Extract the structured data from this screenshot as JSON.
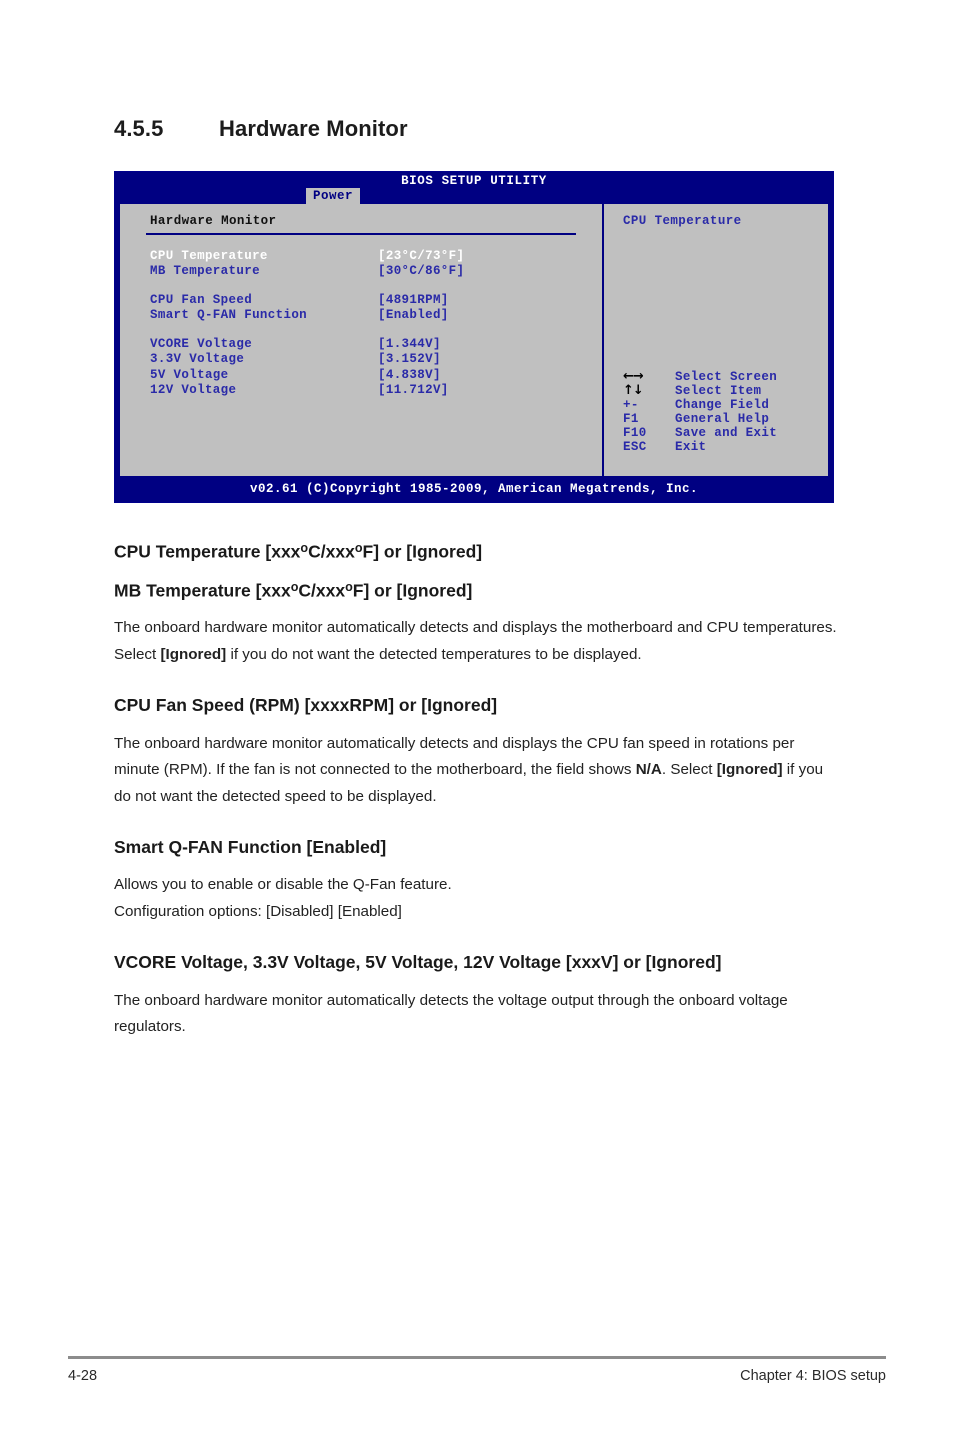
{
  "section": {
    "number": "4.5.5",
    "title": "Hardware Monitor"
  },
  "bios": {
    "title": "BIOS SETUP UTILITY",
    "active_tab": "Power",
    "panel_title": "Hardware Monitor",
    "items": [
      {
        "label": "CPU Temperature",
        "value": "[23°C/73°F]",
        "selected": true
      },
      {
        "label": "MB Temperature",
        "value": "[30°C/86°F]",
        "selected": false
      },
      {
        "label": "CPU Fan Speed",
        "value": "[4891RPM]",
        "selected": false
      },
      {
        "label": "Smart Q-FAN Function",
        "value": "[Enabled]",
        "selected": false
      },
      {
        "label": "VCORE Voltage",
        "value": "[1.344V]",
        "selected": false
      },
      {
        "label": "3.3V Voltage",
        "value": "[3.152V]",
        "selected": false
      },
      {
        "label": "5V Voltage",
        "value": "[4.838V]",
        "selected": false
      },
      {
        "label": "12V Voltage",
        "value": "[11.712V]",
        "selected": false
      }
    ],
    "help_title": "CPU Temperature",
    "legend": [
      {
        "key": "←→",
        "desc": "Select Screen",
        "icon": "left-right-arrow-icon"
      },
      {
        "key": "↑↓",
        "desc": "Select Item",
        "icon": "up-down-arrow-icon"
      },
      {
        "key": "+-",
        "desc": "Change Field",
        "icon": "plus-minus-key"
      },
      {
        "key": "F1",
        "desc": "General Help",
        "icon": "f1-key"
      },
      {
        "key": "F10",
        "desc": "Save and Exit",
        "icon": "f10-key"
      },
      {
        "key": "ESC",
        "desc": "Exit",
        "icon": "esc-key"
      }
    ],
    "footer": "v02.61 (C)Copyright 1985-2009, American Megatrends, Inc."
  },
  "doc": {
    "cpu_temp_heading_a": "CPU Temperature [xxx",
    "cpu_temp_heading_b": "C/xxx",
    "cpu_temp_heading_c": "F] or [Ignored]",
    "mb_temp_heading_a": "MB Temperature [xxx",
    "mb_temp_heading_b": "C/xxx",
    "mb_temp_heading_c": "F] or [Ignored]",
    "degree": "o",
    "temp_body_1": "The onboard hardware monitor automatically detects and displays the motherboard and CPU temperatures. Select ",
    "temp_body_bold": "[Ignored]",
    "temp_body_2": " if you do not want the detected temperatures to be displayed.",
    "fan_heading": "CPU Fan Speed (RPM) [xxxxRPM] or [Ignored]",
    "fan_body_1": "The onboard hardware monitor automatically detects and displays the CPU fan speed in rotations per minute (RPM). If the fan is not connected to the motherboard, the field shows ",
    "fan_body_bold_1": "N/A",
    "fan_body_2": ". Select ",
    "fan_body_bold_2": "[Ignored]",
    "fan_body_3": " if you do not want the detected speed to be displayed.",
    "qfan_heading": "Smart Q-FAN Function [Enabled]",
    "qfan_body_line1": "Allows you to enable or disable the Q-Fan feature.",
    "qfan_body_line2": "Configuration options: [Disabled] [Enabled]",
    "voltage_heading": "VCORE Voltage, 3.3V Voltage, 5V Voltage, 12V Voltage [xxxV] or [Ignored]",
    "voltage_body": "The onboard hardware monitor automatically detects the voltage output through the onboard voltage regulators."
  },
  "page": {
    "number": "4-28",
    "chapter": "Chapter 4: BIOS setup"
  }
}
